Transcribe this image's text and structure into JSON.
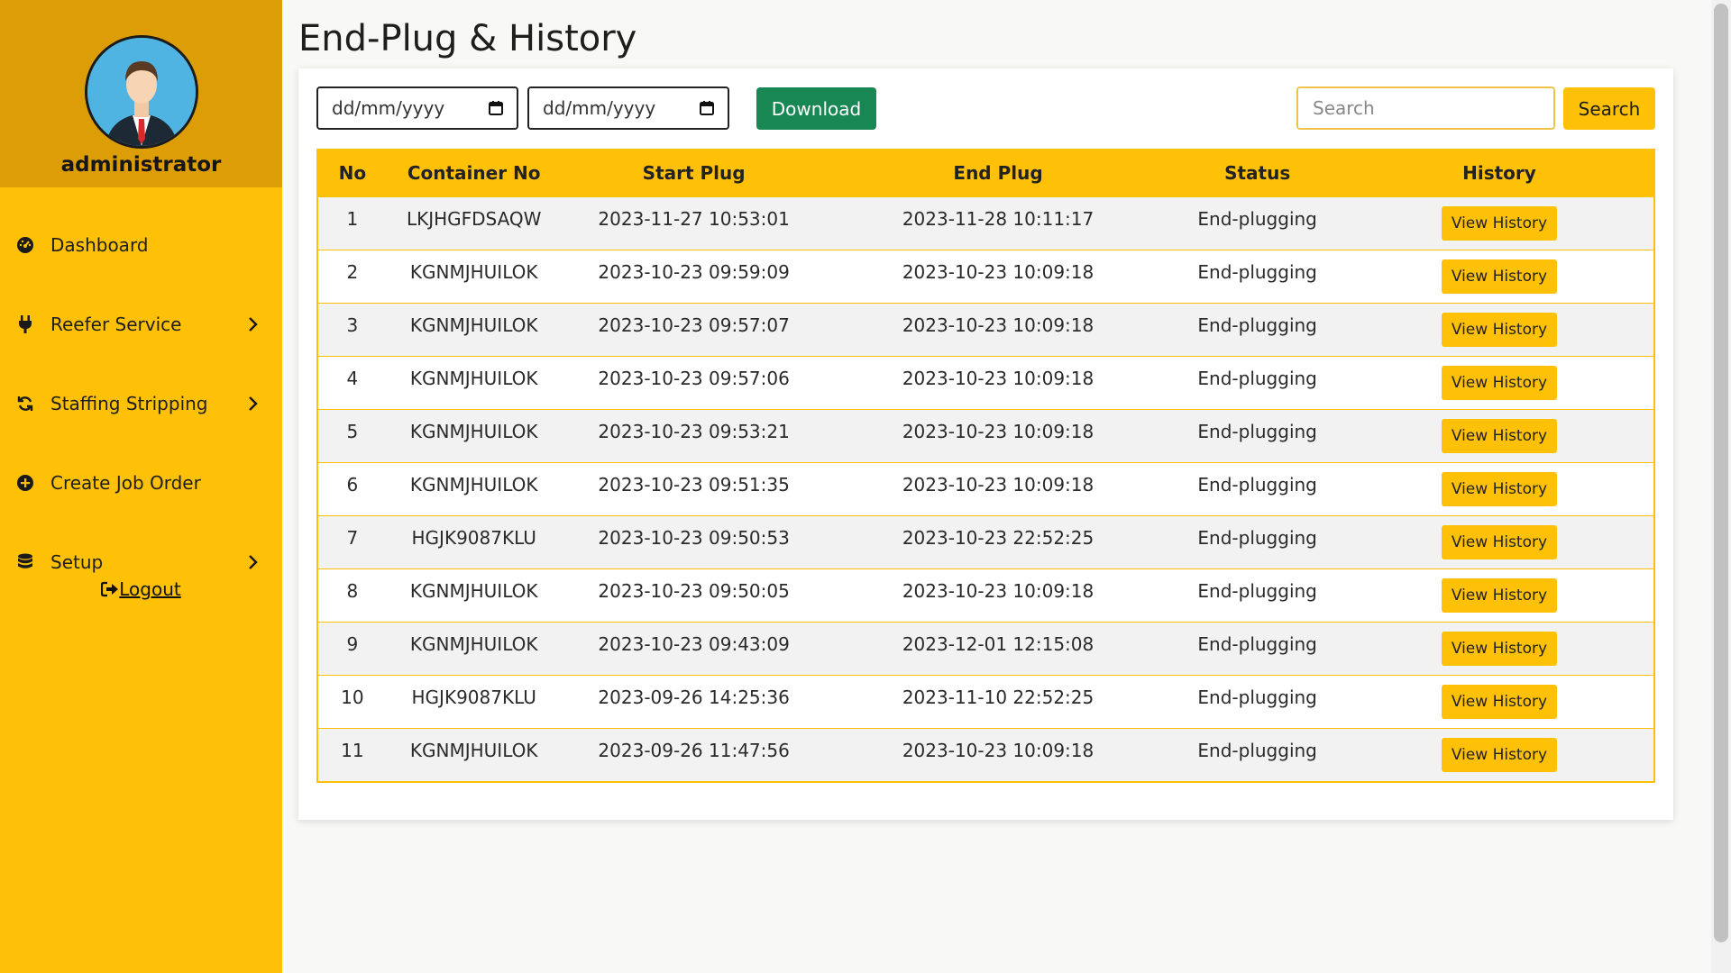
{
  "user": {
    "name": "administrator"
  },
  "sidebar": {
    "items": [
      {
        "label": "Dashboard",
        "icon": "gauge-icon",
        "has_submenu": false
      },
      {
        "label": "Reefer Service",
        "icon": "plug-icon",
        "has_submenu": true
      },
      {
        "label": "Staffing Stripping",
        "icon": "sync-icon",
        "has_submenu": true
      },
      {
        "label": "Create Job Order",
        "icon": "plus-circle-icon",
        "has_submenu": false
      },
      {
        "label": "Setup",
        "icon": "database-icon",
        "has_submenu": true
      }
    ],
    "logout_label": "Logout"
  },
  "page": {
    "title": "End-Plug & History"
  },
  "toolbar": {
    "date_from_placeholder": "dd/mm/yyyy",
    "date_to_placeholder": "dd/mm/yyyy",
    "download_label": "Download",
    "search_placeholder": "Search",
    "search_label": "Search"
  },
  "table": {
    "headers": [
      "No",
      "Container No",
      "Start Plug",
      "End Plug",
      "Status",
      "History"
    ],
    "history_button_label": "View History",
    "rows": [
      {
        "no": "1",
        "container": "LKJHGFDSAQW",
        "start": "2023-11-27 10:53:01",
        "end": "2023-11-28 10:11:17",
        "status": "End-plugging"
      },
      {
        "no": "2",
        "container": "KGNMJHUILOK",
        "start": "2023-10-23 09:59:09",
        "end": "2023-10-23 10:09:18",
        "status": "End-plugging"
      },
      {
        "no": "3",
        "container": "KGNMJHUILOK",
        "start": "2023-10-23 09:57:07",
        "end": "2023-10-23 10:09:18",
        "status": "End-plugging"
      },
      {
        "no": "4",
        "container": "KGNMJHUILOK",
        "start": "2023-10-23 09:57:06",
        "end": "2023-10-23 10:09:18",
        "status": "End-plugging"
      },
      {
        "no": "5",
        "container": "KGNMJHUILOK",
        "start": "2023-10-23 09:53:21",
        "end": "2023-10-23 10:09:18",
        "status": "End-plugging"
      },
      {
        "no": "6",
        "container": "KGNMJHUILOK",
        "start": "2023-10-23 09:51:35",
        "end": "2023-10-23 10:09:18",
        "status": "End-plugging"
      },
      {
        "no": "7",
        "container": "HGJK9087KLU",
        "start": "2023-10-23 09:50:53",
        "end": "2023-10-23 22:52:25",
        "status": "End-plugging"
      },
      {
        "no": "8",
        "container": "KGNMJHUILOK",
        "start": "2023-10-23 09:50:05",
        "end": "2023-10-23 10:09:18",
        "status": "End-plugging"
      },
      {
        "no": "9",
        "container": "KGNMJHUILOK",
        "start": "2023-10-23 09:43:09",
        "end": "2023-12-01 12:15:08",
        "status": "End-plugging"
      },
      {
        "no": "10",
        "container": "HGJK9087KLU",
        "start": "2023-09-26 14:25:36",
        "end": "2023-11-10 22:52:25",
        "status": "End-plugging"
      },
      {
        "no": "11",
        "container": "KGNMJHUILOK",
        "start": "2023-09-26 11:47:56",
        "end": "2023-10-23 10:09:18",
        "status": "End-plugging"
      }
    ]
  },
  "colors": {
    "sidebar": "#ffc107",
    "sidebar_header": "#dc9d07",
    "download": "#198754",
    "accent": "#ffc107"
  }
}
